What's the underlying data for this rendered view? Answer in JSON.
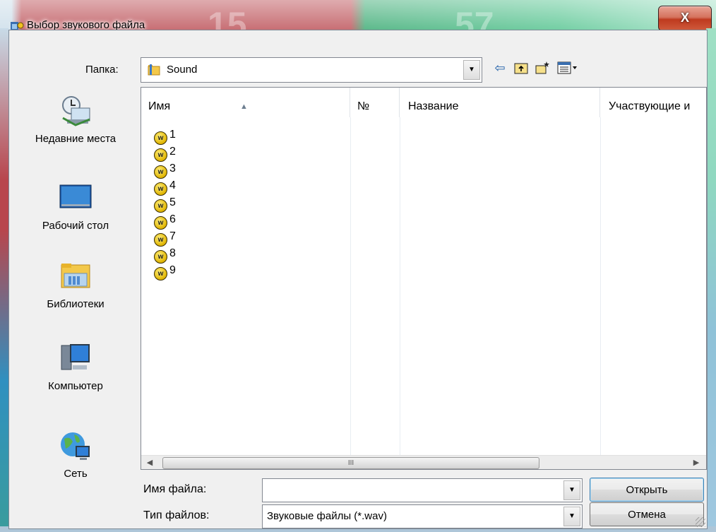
{
  "window": {
    "title": "Выбор звукового файла",
    "bg_numbers": [
      "15",
      "57"
    ],
    "close_label": "X"
  },
  "toolbar": {
    "folder_label": "Папка:",
    "folder_value": "Sound",
    "back_icon": "back-arrow-icon",
    "up_icon": "up-folder-icon",
    "new_folder_icon": "new-folder-icon",
    "view_icon": "view-menu-icon"
  },
  "places": [
    {
      "label": "Недавние места",
      "icon": "recent-places-icon"
    },
    {
      "label": "Рабочий стол",
      "icon": "desktop-icon"
    },
    {
      "label": "Библиотеки",
      "icon": "libraries-icon"
    },
    {
      "label": "Компьютер",
      "icon": "computer-icon"
    },
    {
      "label": "Сеть",
      "icon": "network-icon"
    }
  ],
  "list": {
    "columns": [
      "Имя",
      "№",
      "Название",
      "Участвующие и"
    ],
    "files": [
      "1",
      "2",
      "3",
      "4",
      "5",
      "6",
      "7",
      "8",
      "9"
    ],
    "scroll_thumb_label": "III"
  },
  "form": {
    "filename_label": "Имя файла:",
    "filename_value": "",
    "filetype_label": "Тип файлов:",
    "filetype_value": "Звуковые файлы (*.wav)",
    "open_label": "Открыть",
    "cancel_label": "Отмена"
  },
  "colors": {
    "title_red": "#b8464d",
    "title_green": "#2ea56a",
    "wav_icon": "#e0b400"
  }
}
